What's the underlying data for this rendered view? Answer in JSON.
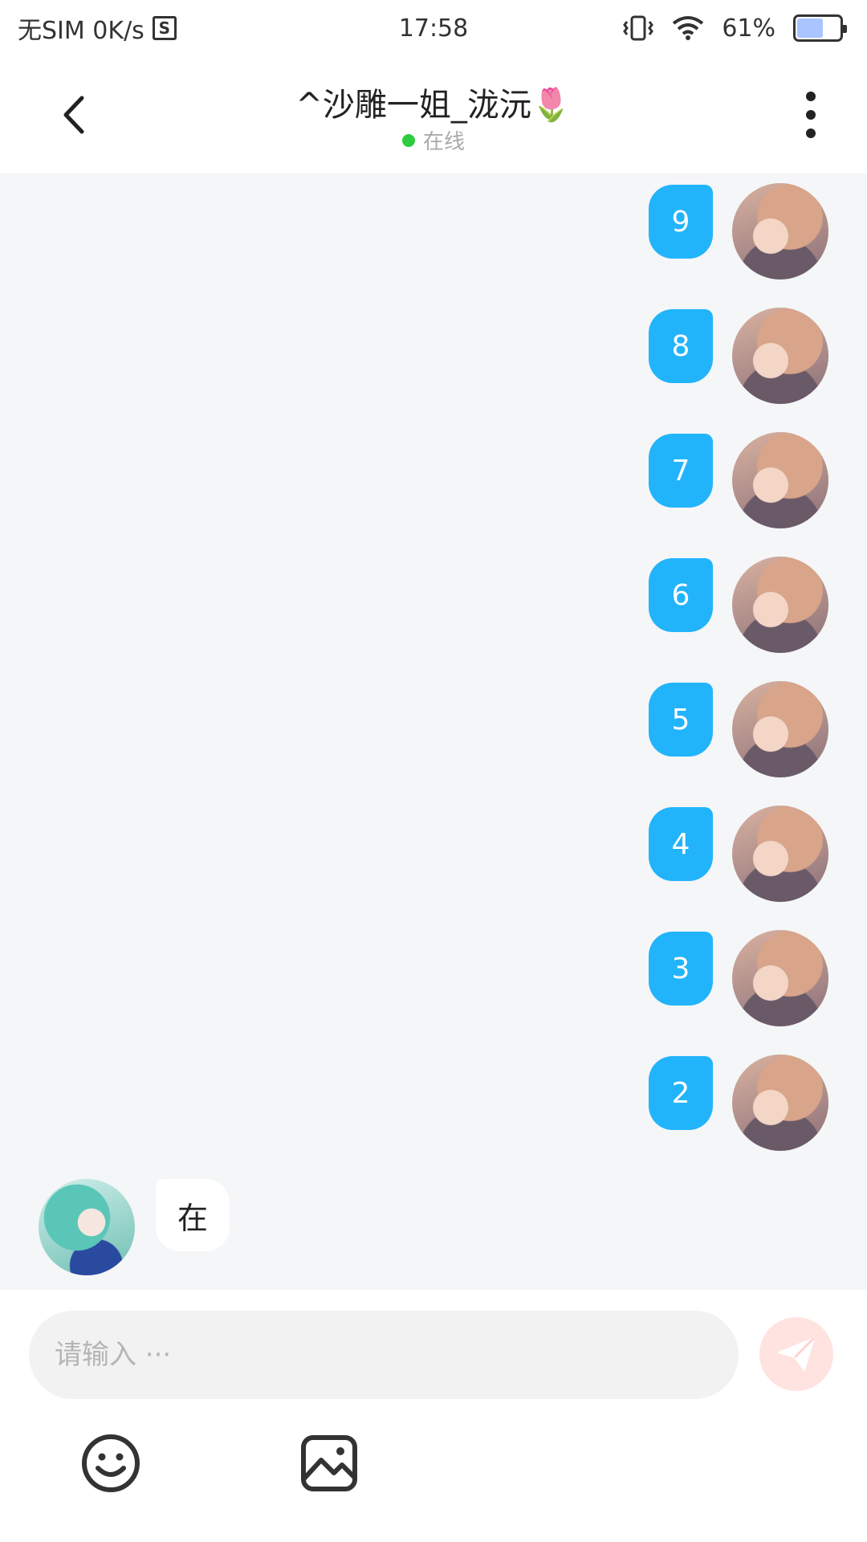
{
  "status_bar": {
    "carrier": "无SIM 0K/s",
    "time": "17:58",
    "battery_percent": "61%",
    "battery_level": 0.61,
    "icons": [
      "sim-icon",
      "vibrate-icon",
      "wifi-icon",
      "battery-icon"
    ]
  },
  "header": {
    "title": "^沙雕一姐_泷沅🌷",
    "presence": "在线",
    "presence_color": "#2ecc40",
    "icons": [
      "back-icon",
      "more-icon"
    ]
  },
  "messages": {
    "outgoing": [
      "9",
      "8",
      "7",
      "6",
      "5",
      "4",
      "3",
      "2"
    ],
    "incoming": [
      "在"
    ]
  },
  "composer": {
    "placeholder": "请输入 ···",
    "icons": [
      "send-icon",
      "emoji-icon",
      "image-icon"
    ]
  },
  "colors": {
    "bubble_out": "#22b4fb",
    "chat_background": "#f4f6f8",
    "send_button": "#ffe3e0"
  }
}
